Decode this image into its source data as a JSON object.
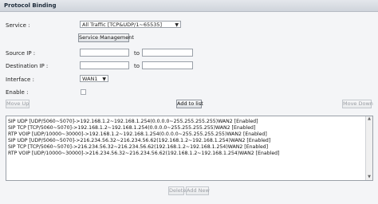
{
  "header": {
    "title": "Protocol Binding"
  },
  "form": {
    "service_label": "Service :",
    "service_value": "All Traffic [TCP&UDP/1~65535]",
    "service_mgmt_button": "Service Management",
    "source_ip_label": "Source IP :",
    "destination_ip_label": "Destination IP :",
    "to_label": "to",
    "interface_label": "Interface :",
    "interface_value": "WAN1",
    "enable_label": "Enable :"
  },
  "buttons": {
    "move_up": "Move Up",
    "add_to_list": "Add to list",
    "move_down": "Move Down",
    "delete": "Delete",
    "add_new": "Add New"
  },
  "bindings": [
    "SIP UDP [UDP/5060~5070]->192.168.1.2~192.168.1.254(0.0.0.0~255.255.255.255)WAN2 [Enabled]",
    "SIP TCP [TCP/5060~5070]->192.168.1.2~192.168.1.254(0.0.0.0~255.255.255.255)WAN2 [Enabled]",
    "RTP VOIP [UDP/10000~30000]->192.168.1.2~192.168.1.254(0.0.0.0~255.255.255.255)WAN2 [Enabled]",
    "SIP UDP [UDP/5060~5070]->216.234.56.32~216.234.56.62(192.168.1.2~192.168.1.254)WAN2 [Enabled]",
    "SIP TCP [TCP/5060~5070]->216.234.56.32~216.234.56.62(192.168.1.2~192.168.1.254)WAN2 [Enabled]",
    "RTP VOIP [UDP/10000~30000]->216.234.56.32~216.234.56.62(192.168.1.2~192.168.1.254)WAN2 [Enabled]"
  ]
}
